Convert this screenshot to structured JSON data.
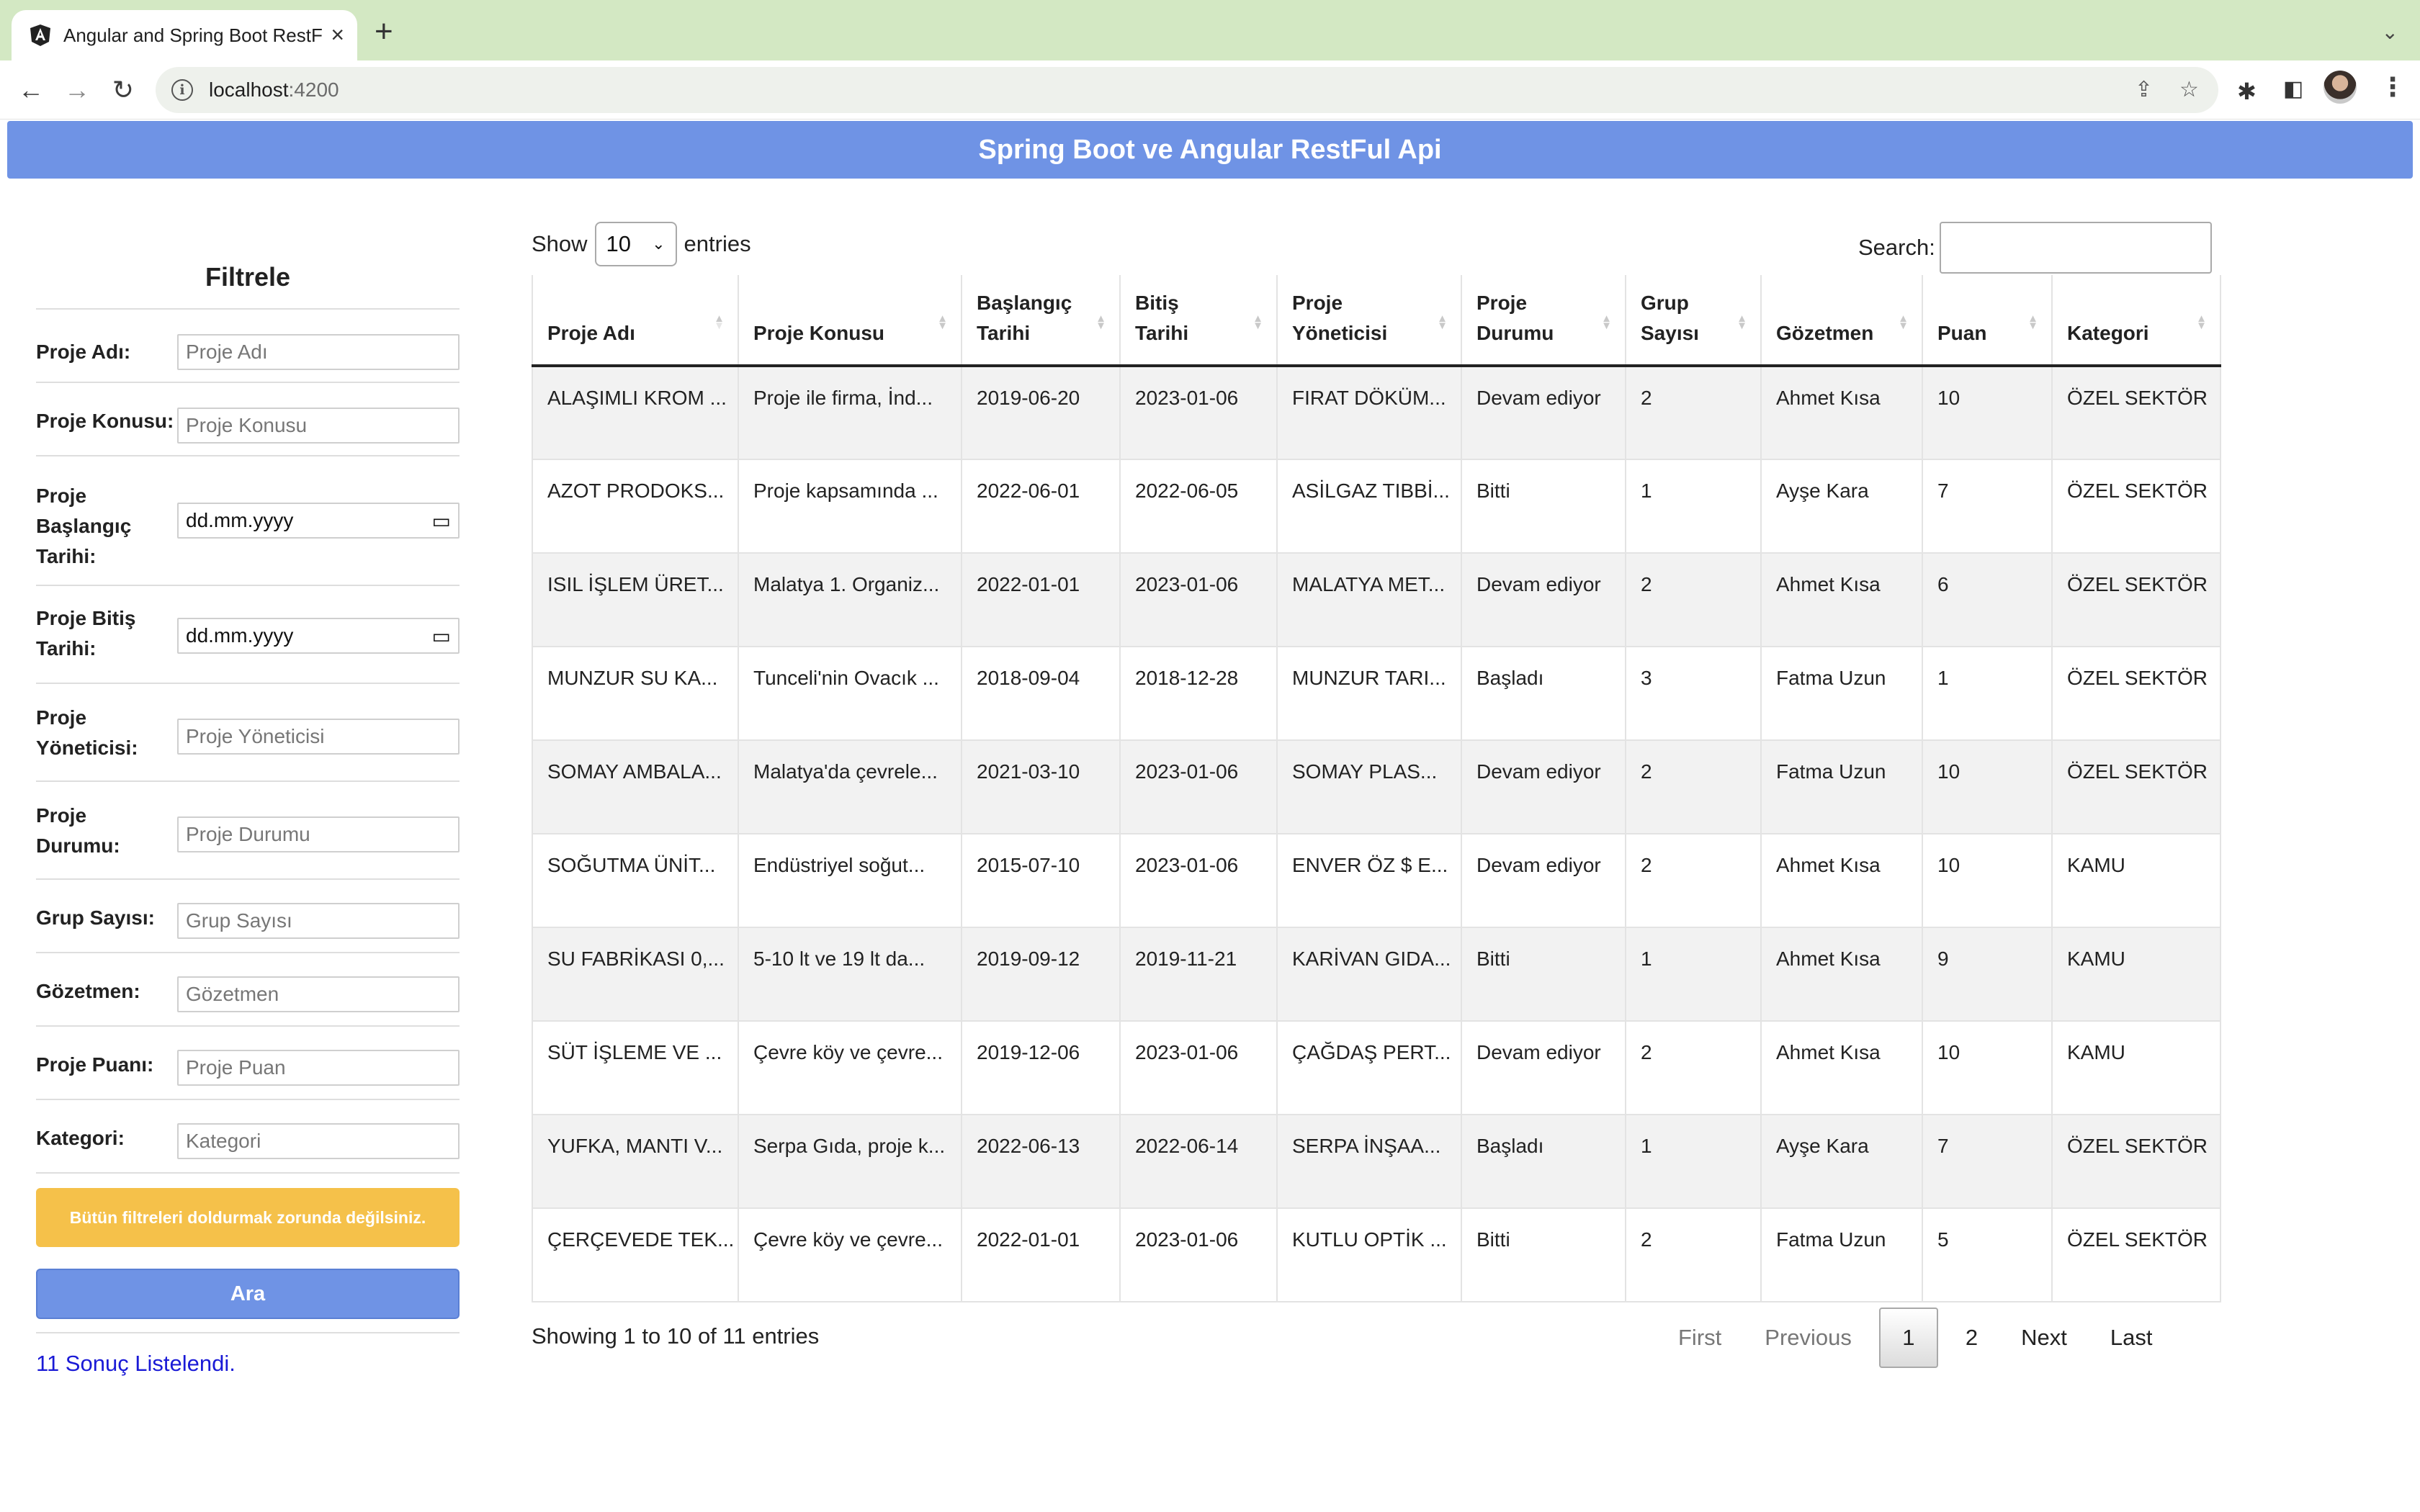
{
  "browser": {
    "tab_title": "Angular and Spring Boot RestF",
    "url_host": "localhost",
    "url_port": ":4200"
  },
  "page": {
    "banner_title": "Spring Boot ve Angular RestFul Api"
  },
  "filter": {
    "heading": "Filtrele",
    "fields": [
      {
        "label": "Proje Adı:",
        "placeholder": "Proje Adı"
      },
      {
        "label": "Proje Konusu:",
        "placeholder": "Proje Konusu"
      },
      {
        "label": "Proje Başlangıç Tarihi:",
        "value": "dd.mm.yyyy"
      },
      {
        "label": "Proje Bitiş Tarihi:",
        "value": "dd.mm.yyyy"
      },
      {
        "label": "Proje Yöneticisi:",
        "placeholder": "Proje Yöneticisi"
      },
      {
        "label": "Proje Durumu:",
        "placeholder": "Proje Durumu"
      },
      {
        "label": "Grup Sayısı:",
        "placeholder": "Grup Sayısı"
      },
      {
        "label": "Gözetmen:",
        "placeholder": "Gözetmen"
      },
      {
        "label": "Proje Puanı:",
        "placeholder": "Proje Puan"
      },
      {
        "label": "Kategori:",
        "placeholder": "Kategori"
      }
    ],
    "warning": "Bütün filtreleri doldurmak zorunda değilsiniz.",
    "search_button": "Ara",
    "result_text": "11 Sonuç Listelendi."
  },
  "table_controls": {
    "show_label": "Show",
    "page_length": "10",
    "entries_label": "entries",
    "search_label": "Search:",
    "search_value": ""
  },
  "table": {
    "columns": [
      "Proje Adı",
      "Proje Konusu",
      "Başlangıç Tarihi",
      "Bitiş Tarihi",
      "Proje Yöneticisi",
      "Proje Durumu",
      "Grup Sayısı",
      "Gözetmen",
      "Puan",
      "Kategori"
    ],
    "rows": [
      [
        "ALAŞIMLI KROM ...",
        "Proje ile firma, İnd...",
        "2019-06-20",
        "2023-01-06",
        "FIRAT DÖKÜM...",
        "Devam ediyor",
        "2",
        "Ahmet Kısa",
        "10",
        "ÖZEL SEKTÖR"
      ],
      [
        "AZOT PRODOKS...",
        "Proje kapsamında ...",
        "2022-06-01",
        "2022-06-05",
        "ASİLGAZ TIBBİ...",
        "Bitti",
        "1",
        "Ayşe Kara",
        "7",
        "ÖZEL SEKTÖR"
      ],
      [
        "ISIL İŞLEM ÜRET...",
        "Malatya 1. Organiz...",
        "2022-01-01",
        "2023-01-06",
        "MALATYA MET...",
        "Devam ediyor",
        "2",
        "Ahmet Kısa",
        "6",
        "ÖZEL SEKTÖR"
      ],
      [
        "MUNZUR SU KA...",
        "Tunceli'nin Ovacık ...",
        "2018-09-04",
        "2018-12-28",
        "MUNZUR TARI...",
        "Başladı",
        "3",
        "Fatma Uzun",
        "1",
        "ÖZEL SEKTÖR"
      ],
      [
        "SOMAY AMBALA...",
        "Malatya'da çevrele...",
        "2021-03-10",
        "2023-01-06",
        "SOMAY PLAS...",
        "Devam ediyor",
        "2",
        "Fatma Uzun",
        "10",
        "ÖZEL SEKTÖR"
      ],
      [
        "SOĞUTMA ÜNİT...",
        "Endüstriyel soğut...",
        "2015-07-10",
        "2023-01-06",
        "ENVER ÖZ $ E...",
        "Devam ediyor",
        "2",
        "Ahmet Kısa",
        "10",
        "KAMU"
      ],
      [
        "SU FABRİKASI 0,...",
        "5-10 lt ve 19 lt da...",
        "2019-09-12",
        "2019-11-21",
        "KARİVAN GIDA...",
        "Bitti",
        "1",
        "Ahmet Kısa",
        "9",
        "KAMU"
      ],
      [
        "SÜT İŞLEME VE ...",
        "Çevre köy ve çevre...",
        "2019-12-06",
        "2023-01-06",
        "ÇAĞDAŞ PERT...",
        "Devam ediyor",
        "2",
        "Ahmet Kısa",
        "10",
        "KAMU"
      ],
      [
        "YUFKA, MANTI V...",
        "Serpa Gıda, proje k...",
        "2022-06-13",
        "2022-06-14",
        "SERPA İNŞAA...",
        "Başladı",
        "1",
        "Ayşe Kara",
        "7",
        "ÖZEL SEKTÖR"
      ],
      [
        "ÇERÇEVEDE TEK...",
        "Çevre köy ve çevre...",
        "2022-01-01",
        "2023-01-06",
        "KUTLU OPTİK ...",
        "Bitti",
        "2",
        "Fatma Uzun",
        "5",
        "ÖZEL SEKTÖR"
      ]
    ]
  },
  "footer": {
    "info": "Showing 1 to 10 of 11 entries",
    "pagination": [
      "First",
      "Previous",
      "1",
      "2",
      "Next",
      "Last"
    ],
    "current_page": "1"
  },
  "colors": {
    "banner": "#6f93e5",
    "warning": "#f5c14a",
    "result_text": "#1a1ad6",
    "tabbar": "#d3e8c3"
  },
  "icons": [
    "angular-favicon-icon",
    "close-icon",
    "plus-icon",
    "back-icon",
    "forward-icon",
    "reload-icon",
    "info-icon",
    "share-icon",
    "star-icon",
    "puzzle-icon",
    "sidebar-icon",
    "avatar",
    "kebab-menu-icon",
    "calendar-icon",
    "sort-icon",
    "chevron-down-icon"
  ]
}
